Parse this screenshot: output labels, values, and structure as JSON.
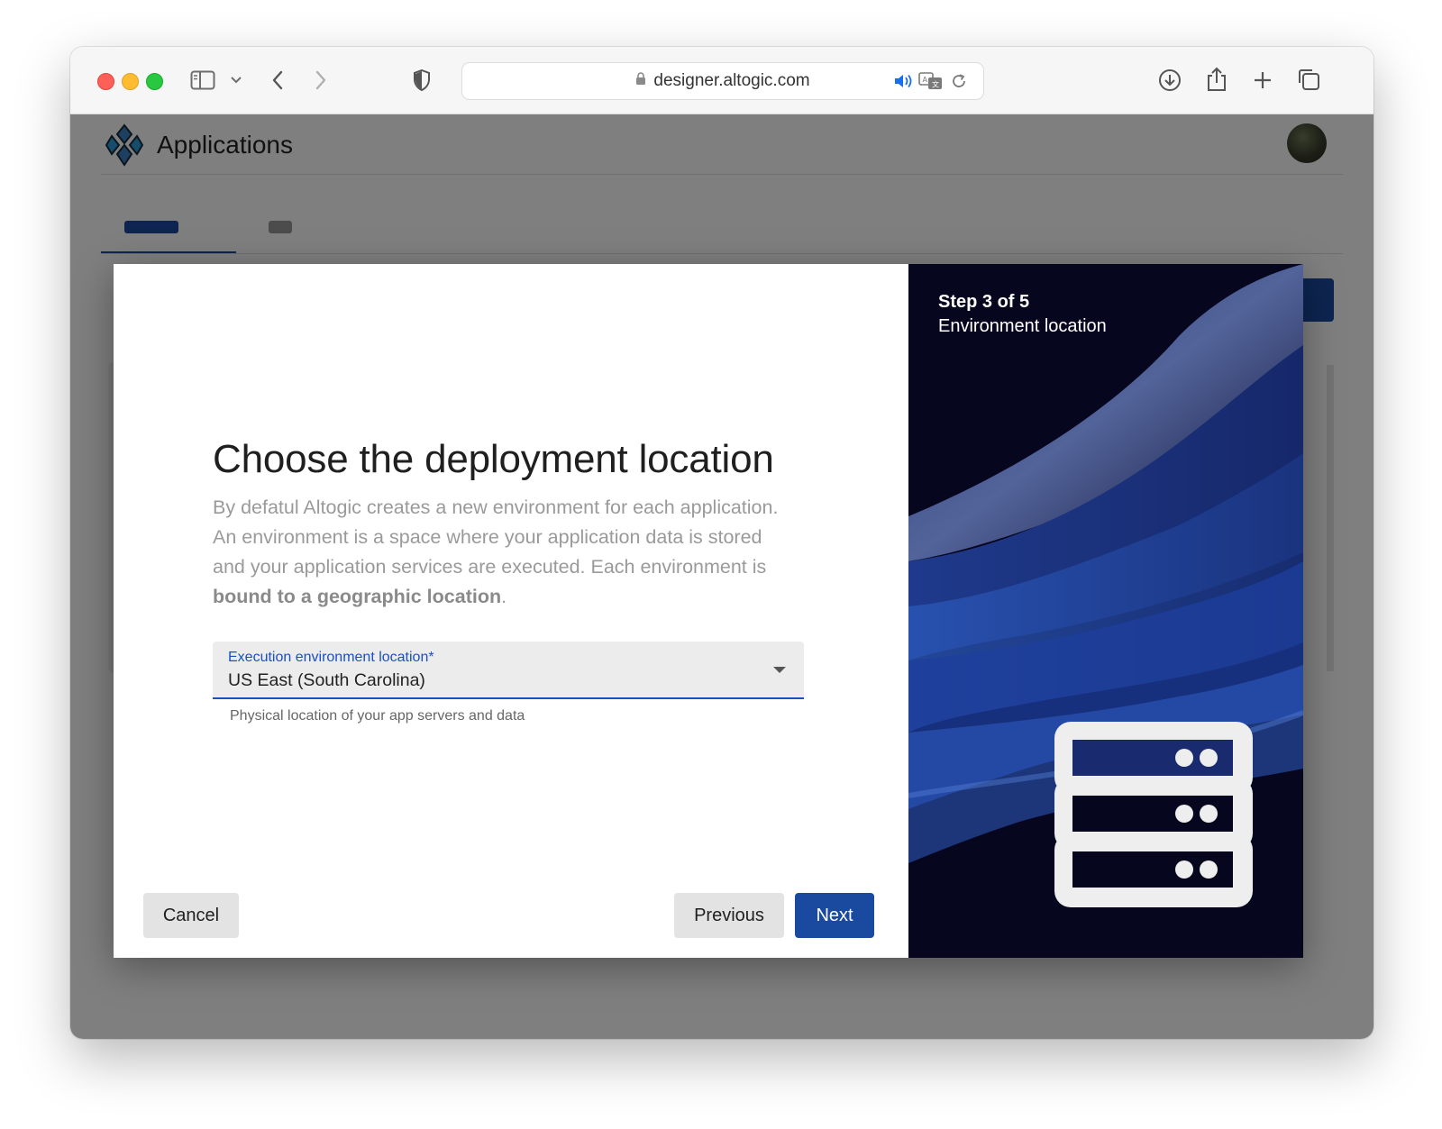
{
  "browser": {
    "url": "designer.altogic.com",
    "icons": [
      "sidebar-icon",
      "chevron-down-icon",
      "back-arrow-icon",
      "forward-arrow-icon",
      "privacy-shield-icon",
      "lock-icon",
      "speaker-icon",
      "translate-icon",
      "reload-icon",
      "download-icon",
      "share-icon",
      "new-tab-icon",
      "tab-overview-icon"
    ]
  },
  "app": {
    "title": "Applications",
    "logo": "altogic-logo-icon"
  },
  "dialog": {
    "title": "Choose the deployment location",
    "description_prefix": "By defatul Altogic creates a new environment for each application. An environment is a space where your application data is stored and your application services are executed. Each environment is ",
    "description_bold": "bound to a geographic location",
    "description_suffix": ".",
    "field": {
      "label": "Execution environment location",
      "required_mark": "*",
      "value": "US East (South Carolina)",
      "helper": "Physical location of your app servers and data"
    },
    "buttons": {
      "cancel": "Cancel",
      "previous": "Previous",
      "next": "Next"
    },
    "side": {
      "step": "Step 3 of 5",
      "subtitle": "Environment location",
      "icon": "server-stack-icon"
    }
  },
  "colors": {
    "primary": "#1a4aa0",
    "field_accent": "#1a50c4",
    "panel_bg": "#07061f"
  }
}
